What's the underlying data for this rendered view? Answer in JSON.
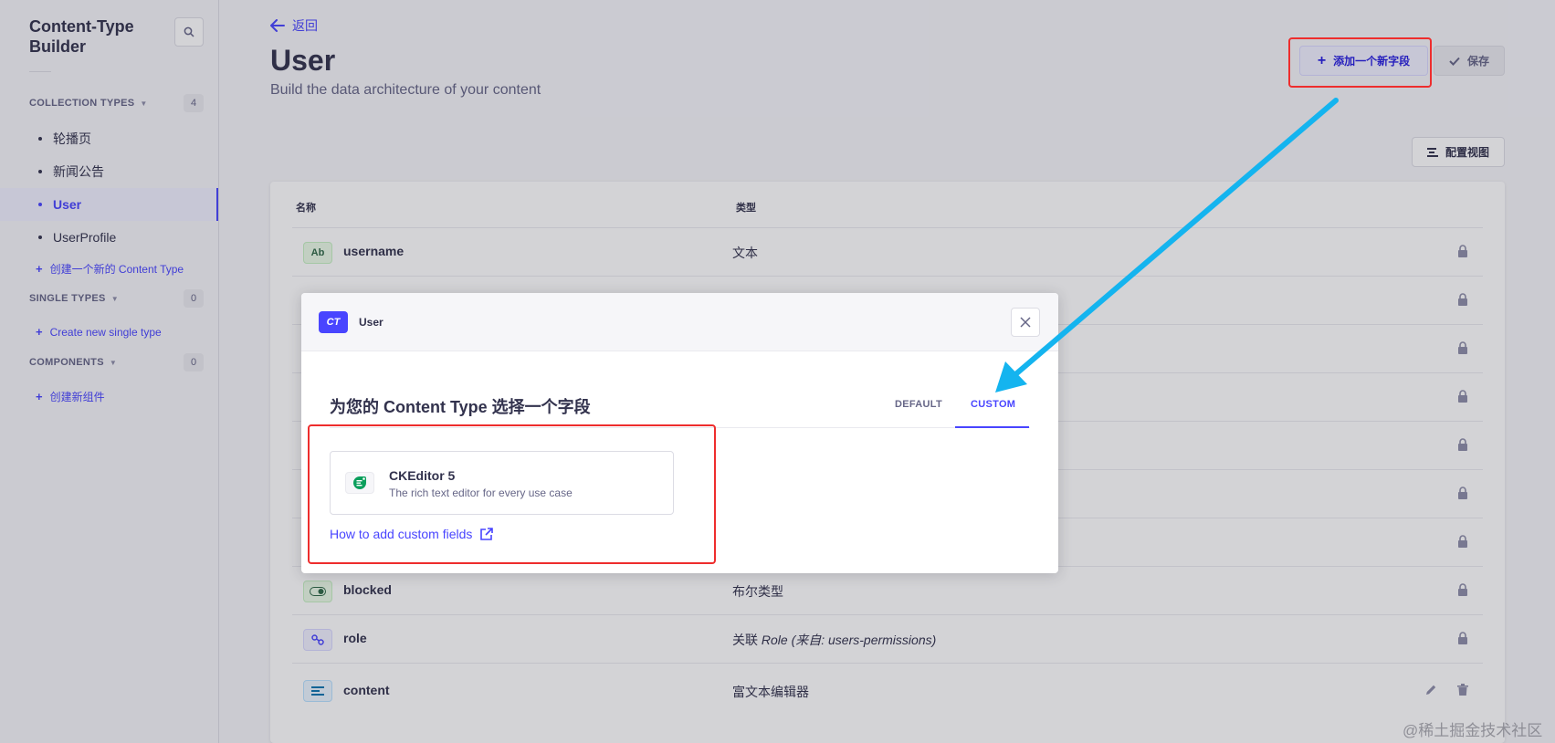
{
  "sidebar": {
    "title": "Content-Type Builder",
    "collection_types": {
      "label": "COLLECTION TYPES",
      "count": "4",
      "items": [
        {
          "label": "轮播页"
        },
        {
          "label": "新闻公告"
        },
        {
          "label": "User"
        },
        {
          "label": "UserProfile"
        }
      ],
      "add_label": "创建一个新的 Content Type"
    },
    "single_types": {
      "label": "SINGLE TYPES",
      "count": "0",
      "add_label": "Create new single type"
    },
    "components": {
      "label": "COMPONENTS",
      "count": "0",
      "add_label": "创建新组件"
    }
  },
  "header": {
    "back_label": "返回",
    "title": "User",
    "subtitle": "Build the data architecture of your content",
    "add_field_label": "添加一个新字段",
    "save_label": "保存",
    "config_view_label": "配置视图"
  },
  "table": {
    "col_name": "名称",
    "col_type": "类型",
    "rows": [
      {
        "name": "username",
        "type": "文本",
        "icon": "Ab"
      },
      {
        "name": "blocked",
        "type": "布尔类型",
        "icon": "toggle-icon"
      },
      {
        "name": "role",
        "type_prefix": "关联 ",
        "type_italic": "Role (来自: users-permissions)",
        "icon": "relation-icon"
      },
      {
        "name": "content",
        "type": "富文本编辑器",
        "icon": "richtext-icon"
      }
    ]
  },
  "modal": {
    "badge": "CT",
    "head_title": "User",
    "heading": "为您的 Content Type 选择一个字段",
    "tabs": [
      {
        "label": "DEFAULT"
      },
      {
        "label": "CUSTOM"
      }
    ],
    "field": {
      "title": "CKEditor 5",
      "description": "The rich text editor for every use case"
    },
    "how_link": "How to add custom fields"
  },
  "watermark": "@稀土掘金技术社区",
  "colors": {
    "primary": "#4945ff",
    "highlight": "#ee2d2d",
    "arrow": "#14b4ef"
  }
}
